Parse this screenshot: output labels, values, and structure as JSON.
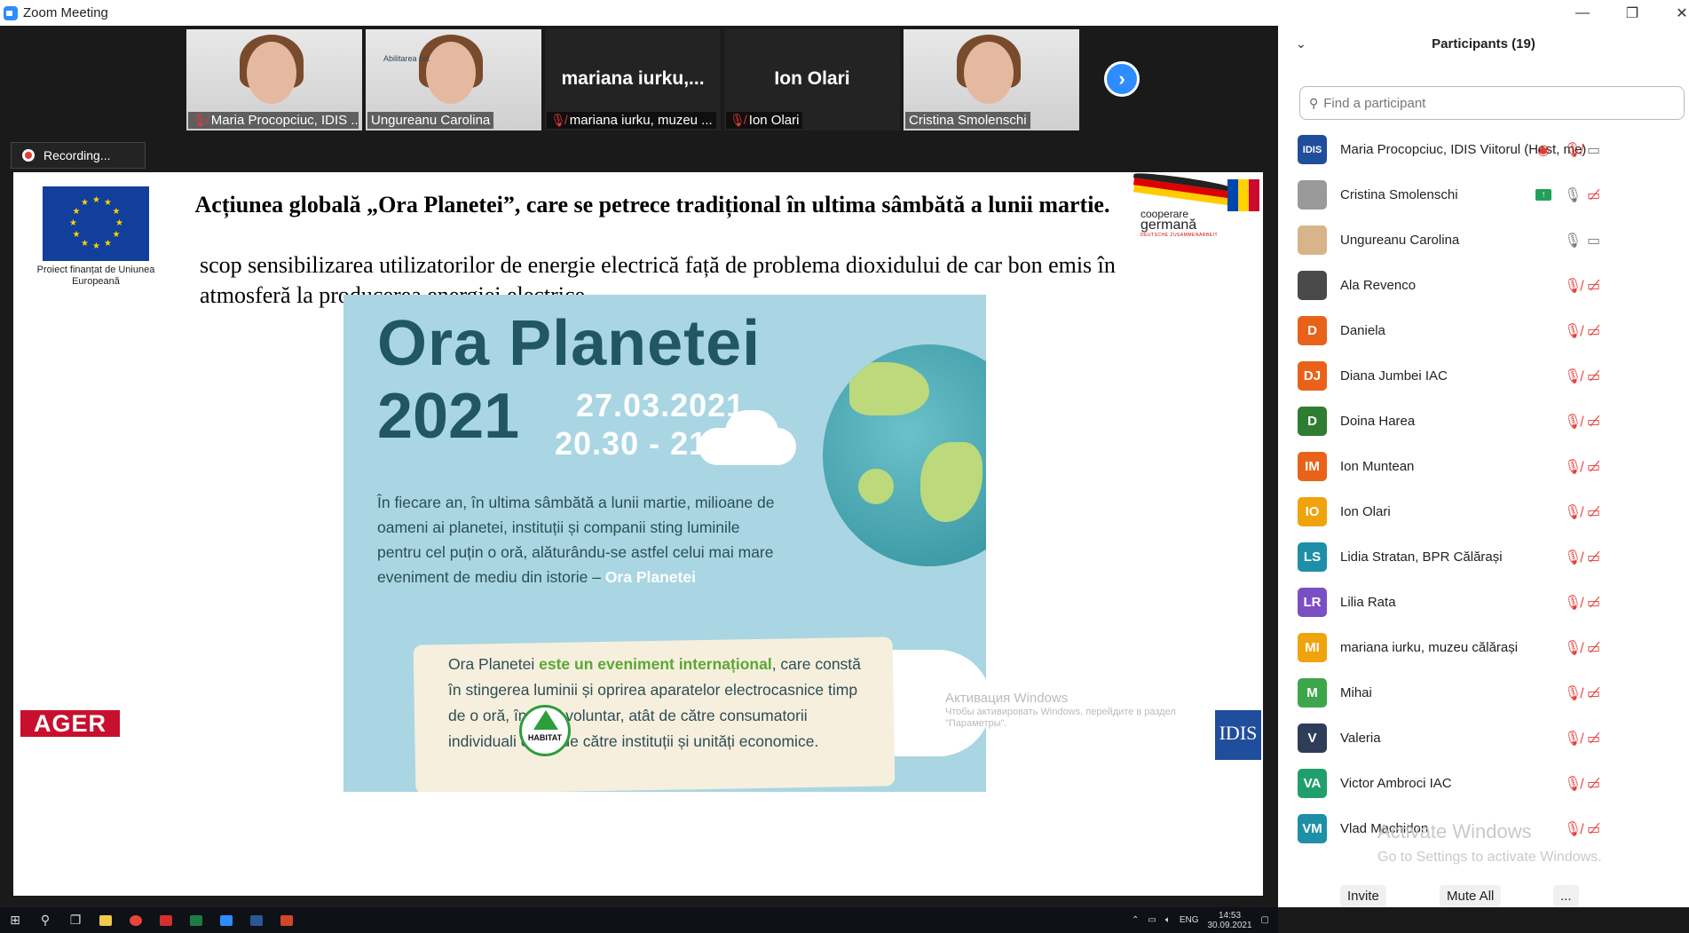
{
  "window": {
    "title": "Zoom Meeting",
    "minimize": "—",
    "restore": "❐",
    "close": "✕"
  },
  "gallery": {
    "tiles": [
      {
        "label": "Maria Procopciuc, IDIS ...",
        "muted": true,
        "video": true
      },
      {
        "label": "Ungureanu Carolina",
        "muted": false,
        "video": true,
        "overlay_text": "Abilitarea cet"
      },
      {
        "label": "mariana iurku, muzeu ...",
        "muted": true,
        "video": false,
        "big_name": "mariana iurku,..."
      },
      {
        "label": "Ion Olari",
        "muted": true,
        "video": false,
        "big_name": "Ion Olari"
      },
      {
        "label": "Cristina Smolenschi",
        "muted": false,
        "video": true,
        "active": true
      }
    ],
    "next_icon": "›"
  },
  "recording": {
    "label": "Recording..."
  },
  "slide": {
    "title": "Acțiunea globală „Ora Planetei”, care se petrece tradițional în ultima sâmbătă a lunii martie.",
    "subtitle": "scop sensibilizarea utilizatorilor de energie electrică față de problema dioxidului de car bon emis în atmosferă la producerea energiei electrice.",
    "eu_caption": "Proiect finanțat de Uniunea Europeană",
    "coop_line1": "cooperare",
    "coop_line2": "germană",
    "coop_line3": "DEUTSCHE ZUSAMMENARBEIT",
    "poster": {
      "title": "Ora Planetei",
      "year": "2021",
      "date": "27.03.2021",
      "time": "20.30 - 21.30",
      "body": "În fiecare an, în ultima sâmbătă a lunii martie, milioane de oameni ai planetei, instituții și companii sting luminile pentru cel puțin o oră, alăturându-se astfel celui mai mare eveniment de mediu din istorie – ",
      "body_bold": "Ora Planetei",
      "note_a": "Ora Planetei ",
      "note_bold": "este un eveniment internațional",
      "note_b": ", care constă în stingerea luminii și oprirea aparatelor electrocasnice timp de o oră, în mod voluntar, atât de către consumatorii individuali cât și de către instituții și unități economice."
    },
    "ager": "AGER",
    "habitat": "HABITAT",
    "idis": "IDIS",
    "activation_title": "Активация Windows",
    "activation_text": "Чтобы активировать Windows, перейдите в раздел \"Параметры\"."
  },
  "taskbar": {
    "lang": "ENG",
    "time": "14:53",
    "date": "30.09.2021"
  },
  "participants": {
    "header": "Participants (19)",
    "search_placeholder": "Find a participant",
    "list": [
      {
        "name": "Maria Procopciuc, IDIS Viitorul (Host, me)",
        "initials": "IDIS",
        "color": "#1f4e9c",
        "mic": "muted",
        "cam": "on",
        "recording": true
      },
      {
        "name": "Cristina Smolenschi",
        "initials": "",
        "color": "#9a9a9a",
        "mic": "on",
        "cam": "off",
        "sharing": true
      },
      {
        "name": "Ungureanu Carolina",
        "initials": "",
        "color": "#d8b48a",
        "mic": "on",
        "cam": "on"
      },
      {
        "name": "Ala Revenco",
        "initials": "",
        "color": "#4a4a4a",
        "mic": "muted",
        "cam": "off"
      },
      {
        "name": "Daniela",
        "initials": "D",
        "color": "#e8621a",
        "mic": "muted",
        "cam": "off"
      },
      {
        "name": "Diana Jumbei IAC",
        "initials": "DJ",
        "color": "#e8621a",
        "mic": "muted",
        "cam": "off"
      },
      {
        "name": "Doina Harea",
        "initials": "D",
        "color": "#2f7d32",
        "mic": "muted",
        "cam": "off"
      },
      {
        "name": "Ion Muntean",
        "initials": "IM",
        "color": "#e8621a",
        "mic": "muted",
        "cam": "off"
      },
      {
        "name": "Ion Olari",
        "initials": "IO",
        "color": "#f0a30a",
        "mic": "muted",
        "cam": "off"
      },
      {
        "name": "Lidia Stratan, BPR Călărași",
        "initials": "LS",
        "color": "#1d8fa8",
        "mic": "muted",
        "cam": "off"
      },
      {
        "name": "Lilia Rata",
        "initials": "LR",
        "color": "#7b4fc4",
        "mic": "muted",
        "cam": "off"
      },
      {
        "name": "mariana iurku, muzeu călărași",
        "initials": "MI",
        "color": "#f0a30a",
        "mic": "muted",
        "cam": "off"
      },
      {
        "name": "Mihai",
        "initials": "M",
        "color": "#3ea64a",
        "mic": "muted",
        "cam": "off"
      },
      {
        "name": "Valeria",
        "initials": "V",
        "color": "#2e3e58",
        "mic": "muted",
        "cam": "off"
      },
      {
        "name": "Victor Ambroci IAC",
        "initials": "VA",
        "color": "#1fa06b",
        "mic": "muted",
        "cam": "off"
      },
      {
        "name": "Vlad Machidon",
        "initials": "VM",
        "color": "#1d8fa8",
        "mic": "muted",
        "cam": "off"
      }
    ],
    "activate_title": "Activate Windows",
    "activate_text": "Go to Settings to activate Windows.",
    "invite": "Invite",
    "mute_all": "Mute All",
    "more": "..."
  },
  "colors": {
    "zoom_blue": "#2d8cff",
    "muted_red": "#e53935",
    "active_tile": "#c8d62a"
  }
}
